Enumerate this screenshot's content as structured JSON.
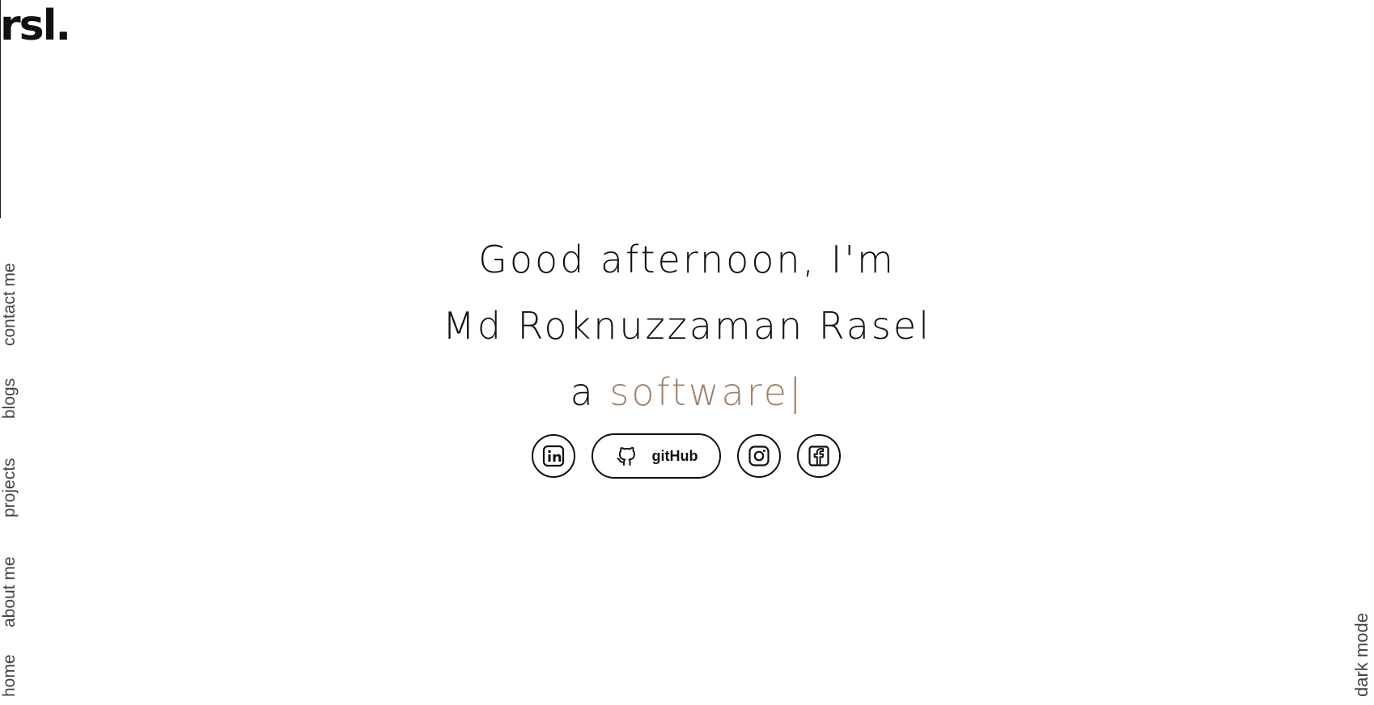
{
  "brand": {
    "logo": "rsl."
  },
  "nav": {
    "items": [
      {
        "label": "home"
      },
      {
        "label": "about me"
      },
      {
        "label": "projects"
      },
      {
        "label": "blogs"
      },
      {
        "label": "contact me"
      }
    ]
  },
  "theme_toggle": {
    "label": "dark mode"
  },
  "hero": {
    "greeting": "Good afternoon, I'm",
    "name": "Md Roknuzzaman Rasel",
    "role_prefix": "a",
    "role_typed": "software|"
  },
  "socials": {
    "linkedin": {
      "icon": "linkedin-icon"
    },
    "github": {
      "icon": "github-icon",
      "label": "gitHub"
    },
    "instagram": {
      "icon": "instagram-icon"
    },
    "facebook": {
      "icon": "facebook-icon"
    }
  },
  "colors": {
    "accent": "#a0826a",
    "text": "#111111",
    "nav_text": "#444444",
    "background": "#ffffff"
  }
}
